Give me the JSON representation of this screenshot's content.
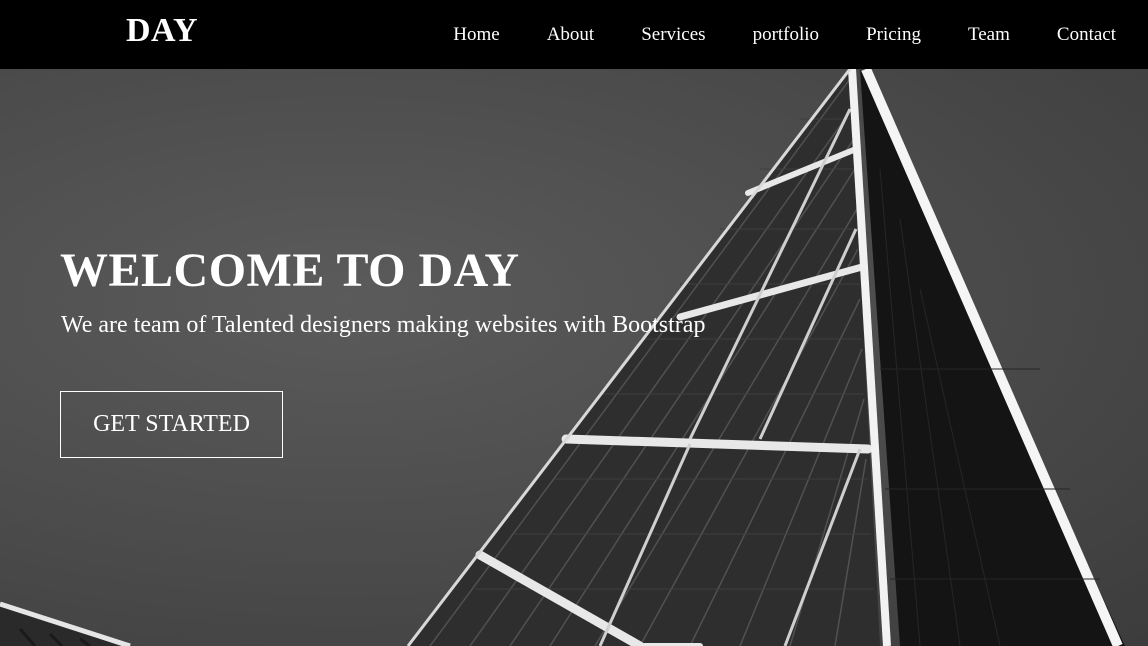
{
  "header": {
    "logo": "DAY",
    "nav": [
      {
        "label": "Home"
      },
      {
        "label": "About"
      },
      {
        "label": "Services"
      },
      {
        "label": "portfolio"
      },
      {
        "label": "Pricing"
      },
      {
        "label": "Team"
      },
      {
        "label": "Contact"
      }
    ]
  },
  "hero": {
    "title": "WELCOME TO DAY",
    "subtitle": "We are team of Talented designers making websites with Bootstrap",
    "cta_label": "GET STARTED",
    "background_image": "black-and-white-glass-skyscraper-photo"
  },
  "colors": {
    "header_bg": "#000000",
    "text": "#ffffff",
    "hero_overlay": "#4a4a4a"
  }
}
